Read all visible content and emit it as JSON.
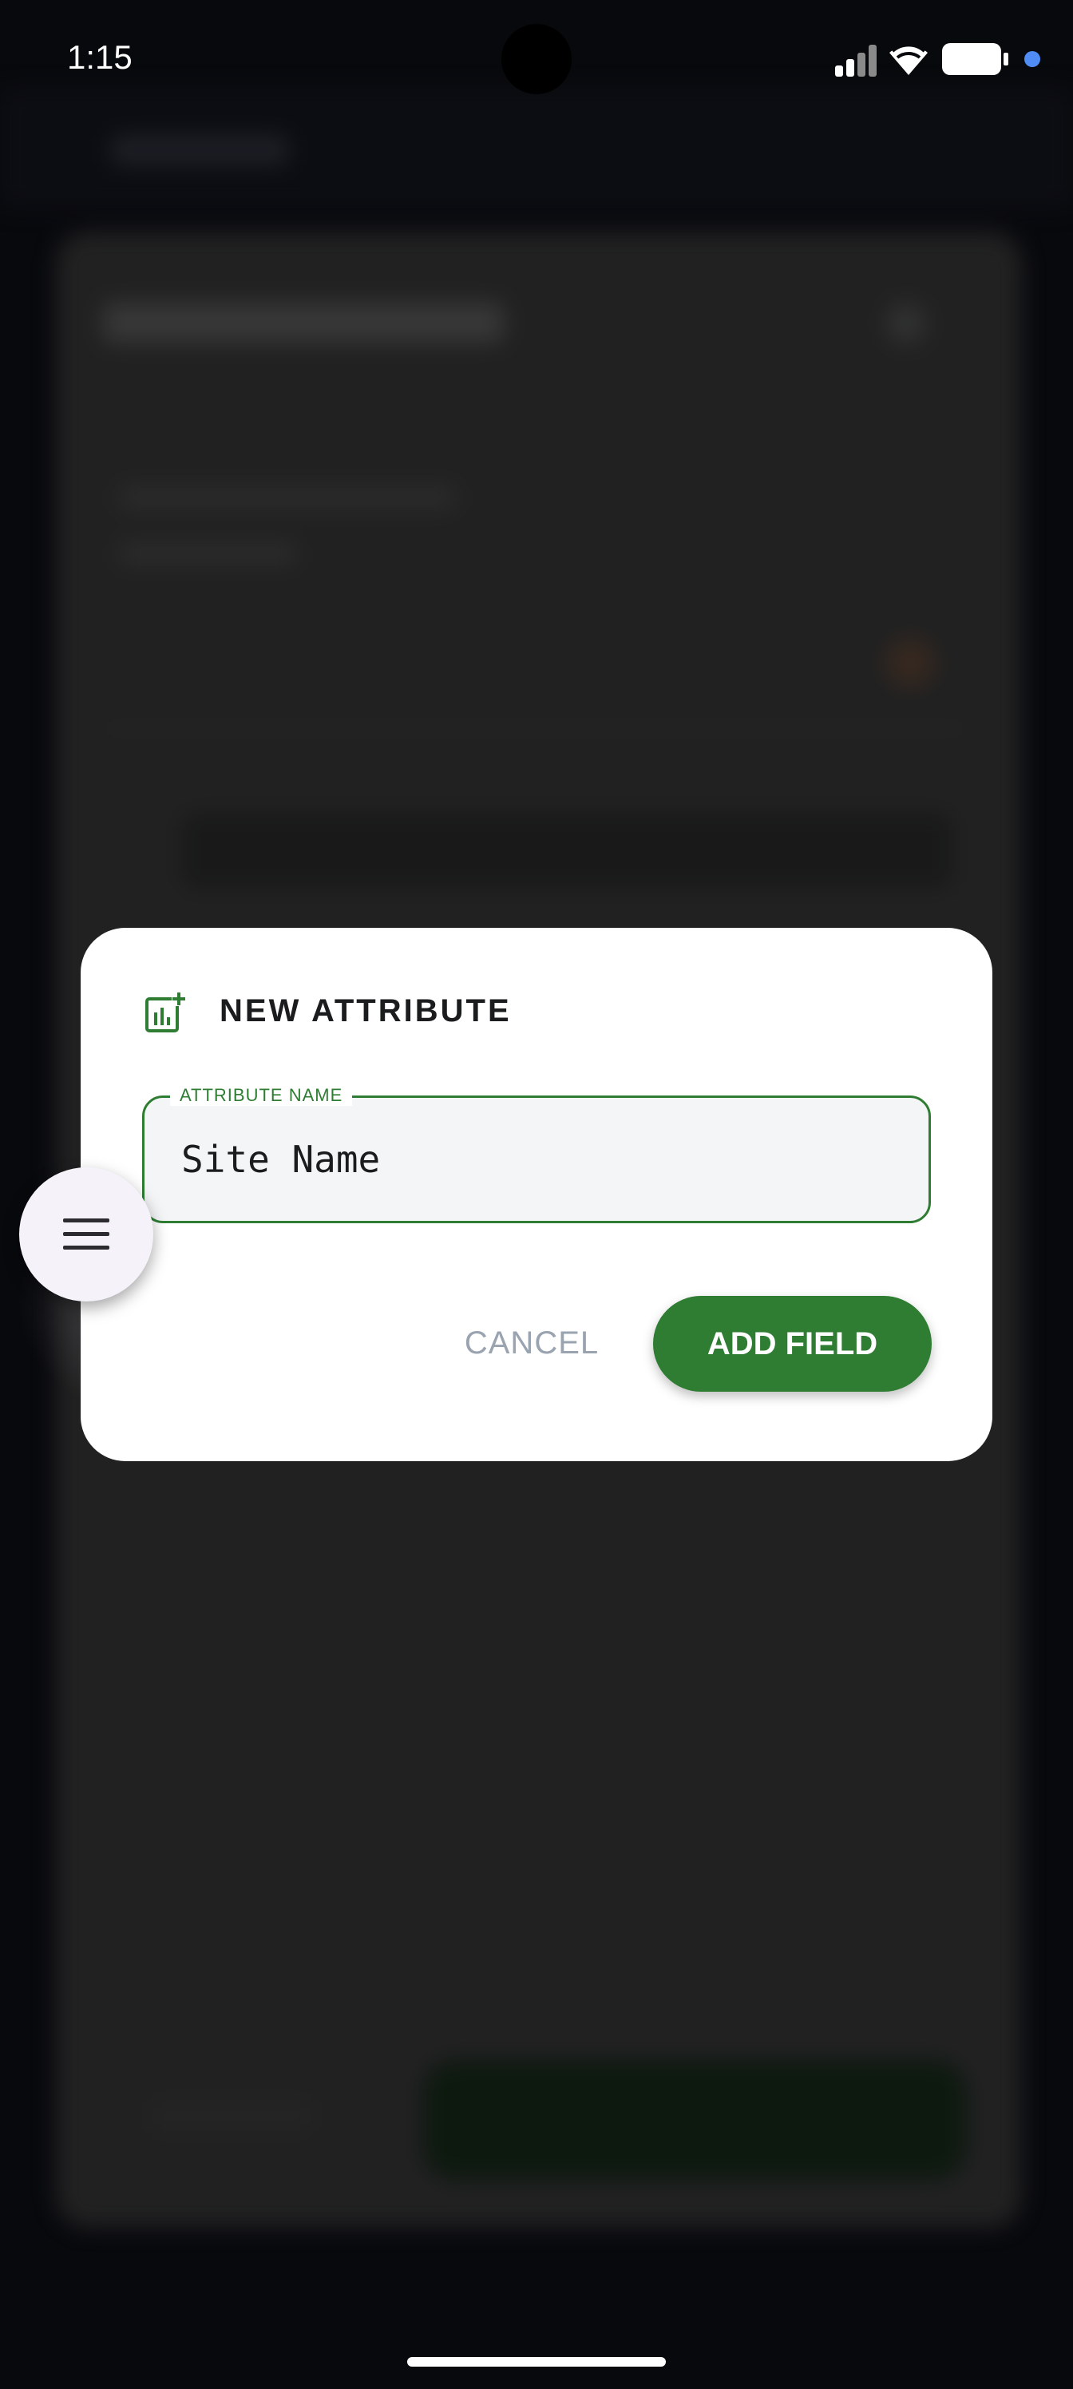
{
  "status_bar": {
    "time": "1:15",
    "icons": [
      "signal-icon",
      "wifi-icon",
      "battery-icon",
      "notification-dot-icon"
    ]
  },
  "dialog": {
    "icon": "add-chart-icon",
    "title": "NEW ATTRIBUTE",
    "field": {
      "label": "ATTRIBUTE NAME",
      "value": "Site Name"
    },
    "cancel_label": "CANCEL",
    "add_label": "ADD FIELD"
  },
  "floating_button": {
    "icon": "menu-icon"
  },
  "colors": {
    "accent": "#2e7d32",
    "dialog_bg": "#ffffff",
    "cancel_text": "#9aa3b0",
    "scrim": "#232323"
  }
}
